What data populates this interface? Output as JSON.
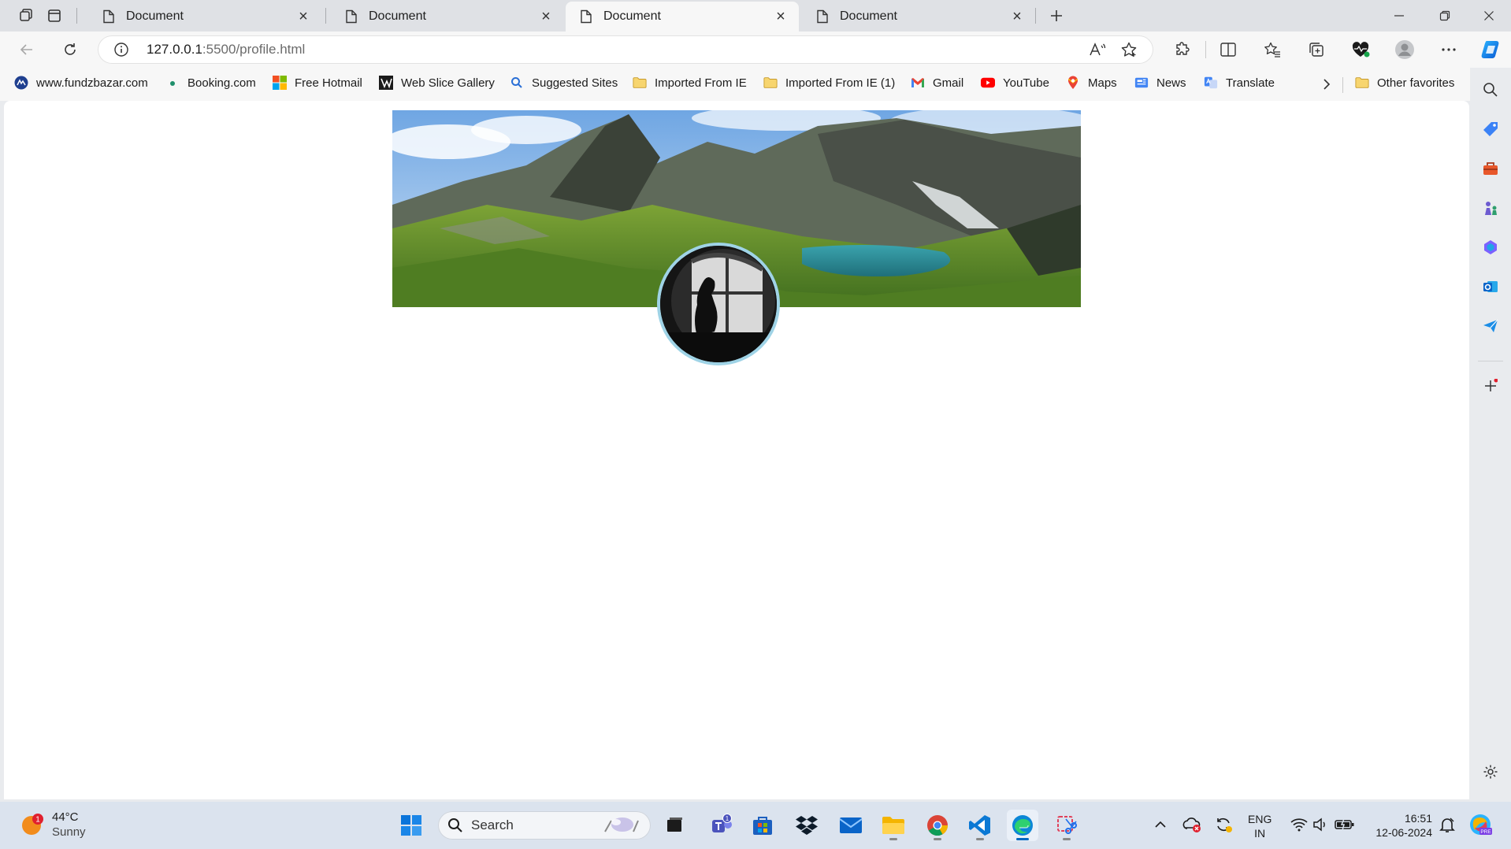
{
  "tabs": [
    {
      "title": "Document",
      "close": "×"
    },
    {
      "title": "Document",
      "close": "×"
    },
    {
      "title": "Document",
      "close": "×"
    },
    {
      "title": "Document",
      "close": "×"
    }
  ],
  "active_tab": 2,
  "address": {
    "host": "127.0.0.1",
    "path": ":5500/profile.html"
  },
  "favorites": [
    {
      "label": "www.fundzbazar.com",
      "icon": "fundzbazar-icon"
    },
    {
      "label": "Booking.com",
      "icon": "booking-icon"
    },
    {
      "label": "Free Hotmail",
      "icon": "microsoft-icon"
    },
    {
      "label": "Web Slice Gallery",
      "icon": "web-slice-icon"
    },
    {
      "label": "Suggested Sites",
      "icon": "search-icon"
    },
    {
      "label": "Imported From IE",
      "icon": "folder-icon"
    },
    {
      "label": "Imported From IE (1)",
      "icon": "folder-icon"
    },
    {
      "label": "Gmail",
      "icon": "gmail-icon"
    },
    {
      "label": "YouTube",
      "icon": "youtube-icon"
    },
    {
      "label": "Maps",
      "icon": "maps-icon"
    },
    {
      "label": "News",
      "icon": "news-icon"
    },
    {
      "label": "Translate",
      "icon": "translate-icon"
    }
  ],
  "other_favorites": "Other favorites",
  "page": {
    "banner": "mountain-lake-banner",
    "avatar": "profile-avatar"
  },
  "taskbar": {
    "weather": {
      "temp": "44°C",
      "condition": "Sunny",
      "badge": "1"
    },
    "search_label": "Search",
    "teams_badge": "1",
    "lang": {
      "line1": "ENG",
      "line2": "IN"
    },
    "clock": {
      "time": "16:51",
      "date": "12-06-2024"
    }
  },
  "colors": {
    "accent": "#0067c0",
    "avatar_ring": "#9fd3e6",
    "tabstrip": "#dfe1e5"
  }
}
